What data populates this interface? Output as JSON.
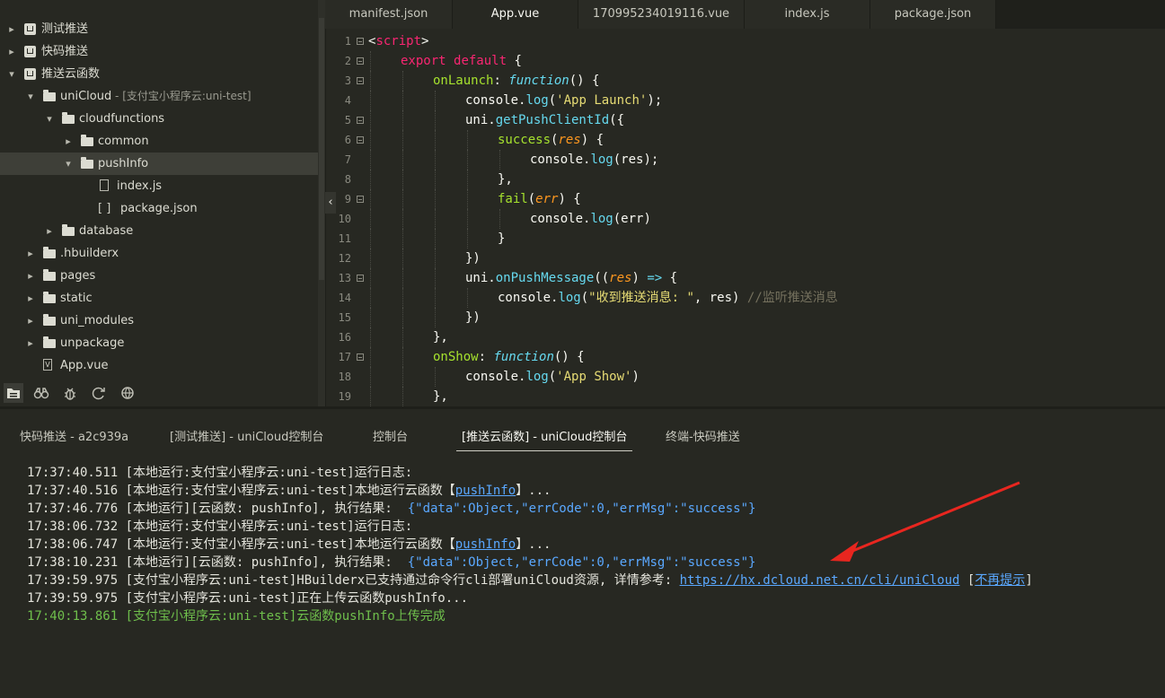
{
  "sidebar": {
    "items": [
      {
        "label": "测试推送",
        "depth": 0,
        "chev": "›",
        "icon": "project"
      },
      {
        "label": "快码推送",
        "depth": 0,
        "chev": "›",
        "icon": "project"
      },
      {
        "label": "推送云函数",
        "depth": 0,
        "chev": "⌄",
        "icon": "project"
      },
      {
        "label": "uniCloud",
        "sub": " - [支付宝小程序云:uni-test]",
        "depth": 1,
        "chev": "⌄",
        "icon": "folder"
      },
      {
        "label": "cloudfunctions",
        "depth": 2,
        "chev": "⌄",
        "icon": "folder"
      },
      {
        "label": "common",
        "depth": 3,
        "chev": "›",
        "icon": "folder"
      },
      {
        "label": "pushInfo",
        "depth": 3,
        "chev": "⌄",
        "icon": "folder",
        "selected": true
      },
      {
        "label": "index.js",
        "depth": 4,
        "chev": "",
        "icon": "js"
      },
      {
        "label": "package.json",
        "depth": 4,
        "chev": "",
        "icon": "json"
      },
      {
        "label": "database",
        "depth": 2,
        "chev": "›",
        "icon": "folder"
      },
      {
        "label": ".hbuilderx",
        "depth": 1,
        "chev": "›",
        "icon": "folder"
      },
      {
        "label": "pages",
        "depth": 1,
        "chev": "›",
        "icon": "folder"
      },
      {
        "label": "static",
        "depth": 1,
        "chev": "›",
        "icon": "folder"
      },
      {
        "label": "uni_modules",
        "depth": 1,
        "chev": "›",
        "icon": "folder"
      },
      {
        "label": "unpackage",
        "depth": 1,
        "chev": "›",
        "icon": "folder"
      },
      {
        "label": "App.vue",
        "depth": 1,
        "chev": "",
        "icon": "vue"
      }
    ],
    "toolbar": [
      "explorer-icon",
      "binoculars-icon",
      "bug-icon",
      "refresh-icon",
      "globe-icon"
    ]
  },
  "editor": {
    "tabs": [
      {
        "label": "manifest.json"
      },
      {
        "label": "App.vue",
        "active": true
      },
      {
        "label": "170995234019116.vue"
      },
      {
        "label": "index.js"
      },
      {
        "label": "package.json"
      }
    ],
    "collapse_glyph": "‹",
    "lines": [
      {
        "n": "1",
        "fold": true,
        "indent": 0,
        "tokens": [
          [
            "pl",
            "<"
          ],
          [
            "tag",
            "script"
          ],
          [
            "pl",
            ">"
          ]
        ]
      },
      {
        "n": "2",
        "fold": true,
        "indent": 1,
        "tokens": [
          [
            "kw",
            "export "
          ],
          [
            "kw",
            "default"
          ],
          [
            "pl",
            " {"
          ]
        ]
      },
      {
        "n": "3",
        "fold": true,
        "indent": 2,
        "tokens": [
          [
            "fn",
            "onLaunch"
          ],
          [
            "pl",
            ": "
          ],
          [
            "it",
            "function"
          ],
          [
            "pl",
            "() {"
          ]
        ]
      },
      {
        "n": "4",
        "fold": false,
        "indent": 3,
        "tokens": [
          [
            "pl",
            "console."
          ],
          [
            "mth",
            "log"
          ],
          [
            "pl",
            "("
          ],
          [
            "str",
            "'App Launch'"
          ],
          [
            "pl",
            ");"
          ]
        ]
      },
      {
        "n": "5",
        "fold": true,
        "indent": 3,
        "tokens": [
          [
            "pl",
            "uni."
          ],
          [
            "mth",
            "getPushClientId"
          ],
          [
            "pl",
            "({"
          ]
        ]
      },
      {
        "n": "6",
        "fold": true,
        "indent": 4,
        "tokens": [
          [
            "fn",
            "success"
          ],
          [
            "pl",
            "("
          ],
          [
            "par",
            "res"
          ],
          [
            "pl",
            ") {"
          ]
        ]
      },
      {
        "n": "7",
        "fold": false,
        "indent": 5,
        "tokens": [
          [
            "pl",
            "console."
          ],
          [
            "mth",
            "log"
          ],
          [
            "pl",
            "(res);"
          ]
        ]
      },
      {
        "n": "8",
        "fold": false,
        "indent": 4,
        "tokens": [
          [
            "pl",
            "},"
          ]
        ]
      },
      {
        "n": "9",
        "fold": true,
        "indent": 4,
        "tokens": [
          [
            "fn",
            "fail"
          ],
          [
            "pl",
            "("
          ],
          [
            "par",
            "err"
          ],
          [
            "pl",
            ") {"
          ]
        ]
      },
      {
        "n": "10",
        "fold": false,
        "indent": 5,
        "tokens": [
          [
            "pl",
            "console."
          ],
          [
            "mth",
            "log"
          ],
          [
            "pl",
            "(err)"
          ]
        ]
      },
      {
        "n": "11",
        "fold": false,
        "indent": 4,
        "tokens": [
          [
            "pl",
            "}"
          ]
        ]
      },
      {
        "n": "12",
        "fold": false,
        "indent": 3,
        "tokens": [
          [
            "pl",
            "})"
          ]
        ]
      },
      {
        "n": "13",
        "fold": true,
        "indent": 3,
        "tokens": [
          [
            "pl",
            "uni."
          ],
          [
            "mth",
            "onPushMessage"
          ],
          [
            "pl",
            "(("
          ],
          [
            "par",
            "res"
          ],
          [
            "pl",
            ") "
          ],
          [
            "mth",
            "=>"
          ],
          [
            "pl",
            " {"
          ]
        ]
      },
      {
        "n": "14",
        "fold": false,
        "indent": 4,
        "tokens": [
          [
            "pl",
            "console."
          ],
          [
            "mth",
            "log"
          ],
          [
            "pl",
            "("
          ],
          [
            "str",
            "\"收到推送消息: \""
          ],
          [
            "pl",
            ", res) "
          ],
          [
            "cm",
            "//监听推送消息"
          ]
        ]
      },
      {
        "n": "15",
        "fold": false,
        "indent": 3,
        "tokens": [
          [
            "pl",
            "})"
          ]
        ]
      },
      {
        "n": "16",
        "fold": false,
        "indent": 2,
        "tokens": [
          [
            "pl",
            "},"
          ]
        ]
      },
      {
        "n": "17",
        "fold": true,
        "indent": 2,
        "tokens": [
          [
            "fn",
            "onShow"
          ],
          [
            "pl",
            ": "
          ],
          [
            "it",
            "function"
          ],
          [
            "pl",
            "() {"
          ]
        ]
      },
      {
        "n": "18",
        "fold": false,
        "indent": 3,
        "tokens": [
          [
            "pl",
            "console."
          ],
          [
            "mth",
            "log"
          ],
          [
            "pl",
            "("
          ],
          [
            "str",
            "'App Show'"
          ],
          [
            "pl",
            ")"
          ]
        ]
      },
      {
        "n": "19",
        "fold": false,
        "indent": 2,
        "tokens": [
          [
            "pl",
            "},"
          ]
        ]
      }
    ]
  },
  "console": {
    "tabs": [
      {
        "label": "快码推送 - a2c939a"
      },
      {
        "label": "[测试推送] - uniCloud控制台"
      },
      {
        "label": "控制台"
      },
      {
        "label": "[推送云函数] - uniCloud控制台",
        "active": true
      },
      {
        "label": "终端-快码推送"
      }
    ],
    "lines": [
      {
        "parts": [
          [
            "t",
            "17:37:40.511 [本地运行:支付宝小程序云:uni-test]运行日志:"
          ]
        ]
      },
      {
        "parts": [
          [
            "t",
            "17:37:40.516 [本地运行:支付宝小程序云:uni-test]本地运行云函数【"
          ],
          [
            "lnk",
            "pushInfo"
          ],
          [
            "t",
            "】..."
          ]
        ]
      },
      {
        "parts": [
          [
            "t",
            "17:37:46.776 [本地运行][云函数: pushInfo], 执行结果:  "
          ],
          [
            "obj",
            "{\"data\":Object,\"errCode\":0,\"errMsg\":\"success\"}"
          ]
        ]
      },
      {
        "parts": [
          [
            "t",
            "17:38:06.732 [本地运行:支付宝小程序云:uni-test]运行日志:"
          ]
        ]
      },
      {
        "parts": [
          [
            "t",
            "17:38:06.747 [本地运行:支付宝小程序云:uni-test]本地运行云函数【"
          ],
          [
            "lnk",
            "pushInfo"
          ],
          [
            "t",
            "】..."
          ]
        ]
      },
      {
        "parts": [
          [
            "t",
            "17:38:10.231 [本地运行][云函数: pushInfo], 执行结果:  "
          ],
          [
            "obj",
            "{\"data\":Object,\"errCode\":0,\"errMsg\":\"success\"}"
          ]
        ]
      },
      {
        "parts": [
          [
            "t",
            "17:39:59.975 [支付宝小程序云:uni-test]HBuilderx已支持通过命令行cli部署uniCloud资源, 详情参考: "
          ],
          [
            "lnk",
            "https://hx.dcloud.net.cn/cli/uniCloud"
          ],
          [
            "t",
            " ["
          ],
          [
            "lnk",
            "不再提示"
          ],
          [
            "t",
            "]"
          ]
        ]
      },
      {
        "parts": [
          [
            "t",
            "17:39:59.975 [支付宝小程序云:uni-test]正在上传云函数pushInfo..."
          ]
        ]
      },
      {
        "green": true,
        "parts": [
          [
            "t",
            "17:40:13.861 [支付宝小程序云:uni-test]云函数pushInfo上传完成"
          ]
        ]
      }
    ]
  },
  "colors": {
    "bg": "#272822",
    "arrow": "#e8261f",
    "link": "#5aa8ff",
    "success": "#6fbf4c"
  }
}
